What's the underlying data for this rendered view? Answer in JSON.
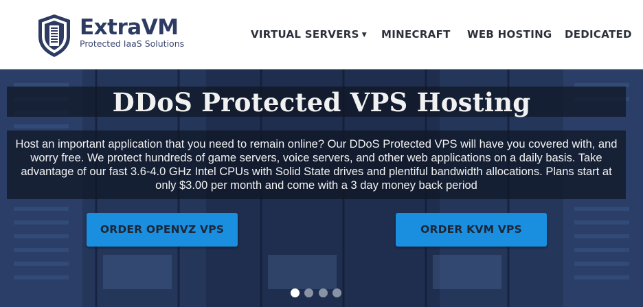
{
  "logo": {
    "brand": "ExtraVM",
    "tagline": "Protected IaaS Solutions"
  },
  "nav": {
    "items": [
      {
        "label": "VIRTUAL SERVERS",
        "has_dropdown": true
      },
      {
        "label": "MINECRAFT"
      },
      {
        "label": "WEB HOSTING"
      },
      {
        "label": "DEDICATED"
      }
    ],
    "caret": "▼"
  },
  "hero": {
    "title": "DDoS Protected VPS Hosting",
    "description": "Host an important application that you need to remain online? Our DDoS Protected VPS will have you covered with, and worry free. We protect hundreds of game servers, voice servers, and other web applications on a daily basis. Take advantage of our fast 3.6-4.0 GHz Intel CPUs with Solid State drives and plentiful bandwidth allocations. Plans start at only $3.00 per month and come with a 3 day money back period",
    "buttons": {
      "openvz": "ORDER OPENVZ VPS",
      "kvm": "ORDER KVM VPS"
    },
    "slides": {
      "count": 4,
      "active": 1
    }
  },
  "colors": {
    "brand_navy": "#2d3b63",
    "button_blue": "#1a8fe0",
    "nav_text": "#2a2f3a"
  }
}
